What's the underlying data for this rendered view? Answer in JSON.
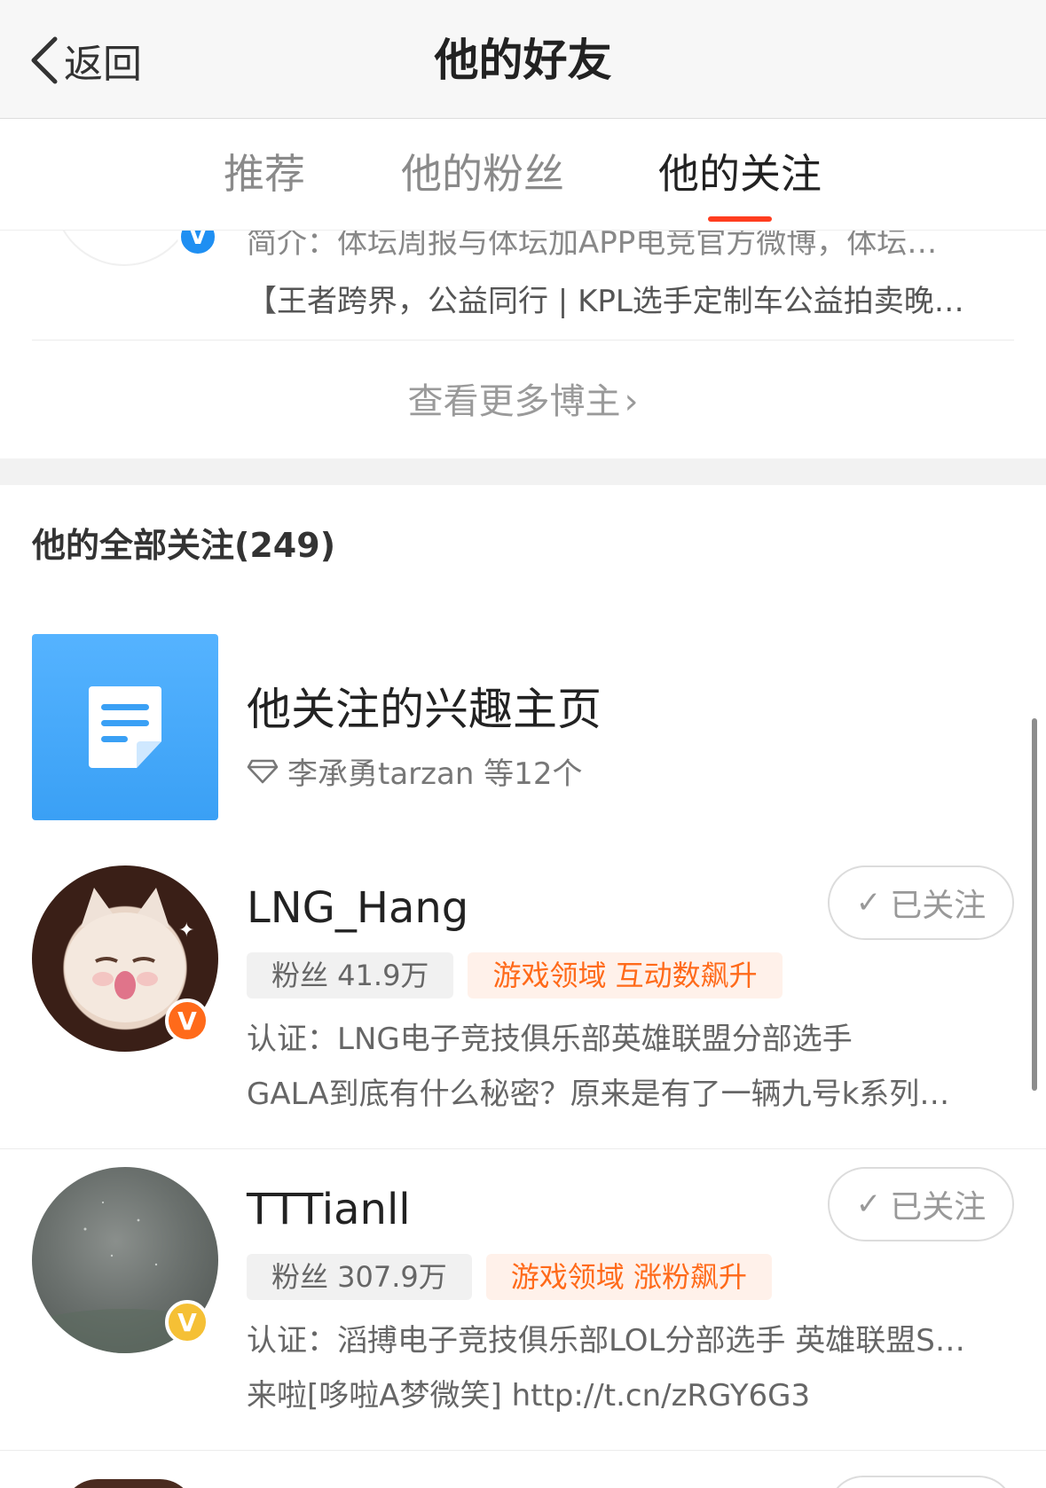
{
  "nav": {
    "back_label": "返回",
    "title": "他的好友"
  },
  "tabs": [
    {
      "label": "推荐",
      "active": false
    },
    {
      "label": "他的粉丝",
      "active": false
    },
    {
      "label": "他的关注",
      "active": true
    }
  ],
  "partial_card": {
    "intro": "简介：体坛周报与体坛加APP电竞官方微博，体坛…",
    "latest": "【王者跨界，公益同行 | KPL选手定制车公益拍卖晚…",
    "verified": "V"
  },
  "more_bloggers": "查看更多博主",
  "section_title": "他的全部关注(249)",
  "interest": {
    "title": "他关注的兴趣主页",
    "subtitle": "李承勇tarzan 等12个",
    "icon": "document-icon"
  },
  "users": [
    {
      "name": "LNG_Hang",
      "follow_label": "已关注",
      "fans_tag": "粉丝 41.9万",
      "domain_tag": "游戏领域  互动数飙升",
      "desc1": "认证：LNG电子竞技俱乐部英雄联盟分部选手",
      "desc2": "GALA到底有什么秘密？原来是有了一辆九号k系列…",
      "badge": "V",
      "badge_color": "#ff6a1a"
    },
    {
      "name": "TTTianll",
      "follow_label": "已关注",
      "fans_tag": "粉丝 307.9万",
      "domain_tag": "游戏领域  涨粉飙升",
      "desc1": "认证：滔搏电子竞技俱乐部LOL分部选手 英雄联盟S…",
      "desc2": "来啦[哆啦A梦微笑] http://t.cn/zRGY6G3",
      "badge": "V",
      "badge_color": "#f5c035"
    }
  ],
  "colors": {
    "accent_red": "#ff3d1f",
    "interest_blue": "#3aa0f5",
    "tag_orange": "#ff6a1a"
  }
}
